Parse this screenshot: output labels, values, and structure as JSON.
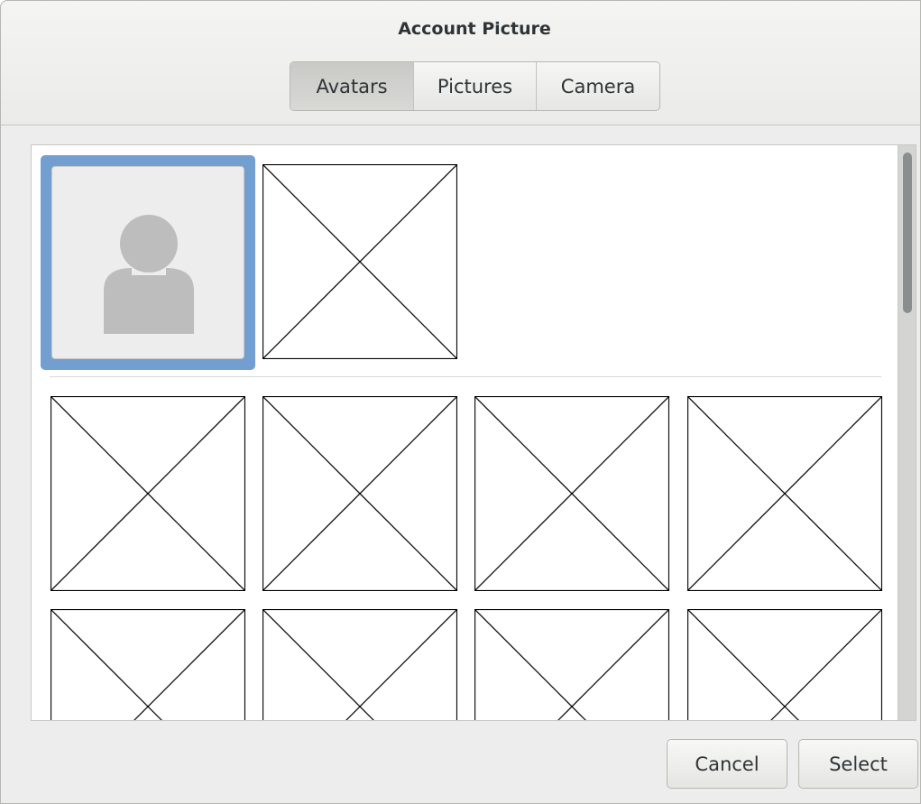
{
  "dialog": {
    "title": "Account Picture"
  },
  "tabs": [
    {
      "label": "Avatars",
      "active": true
    },
    {
      "label": "Pictures",
      "active": false
    },
    {
      "label": "Camera",
      "active": false
    }
  ],
  "avatars": {
    "default_icon": "person-icon",
    "placeholder_icon": "missing-image-icon",
    "selection_color": "#729fcf"
  },
  "footer": {
    "cancel_label": "Cancel",
    "select_label": "Select"
  }
}
